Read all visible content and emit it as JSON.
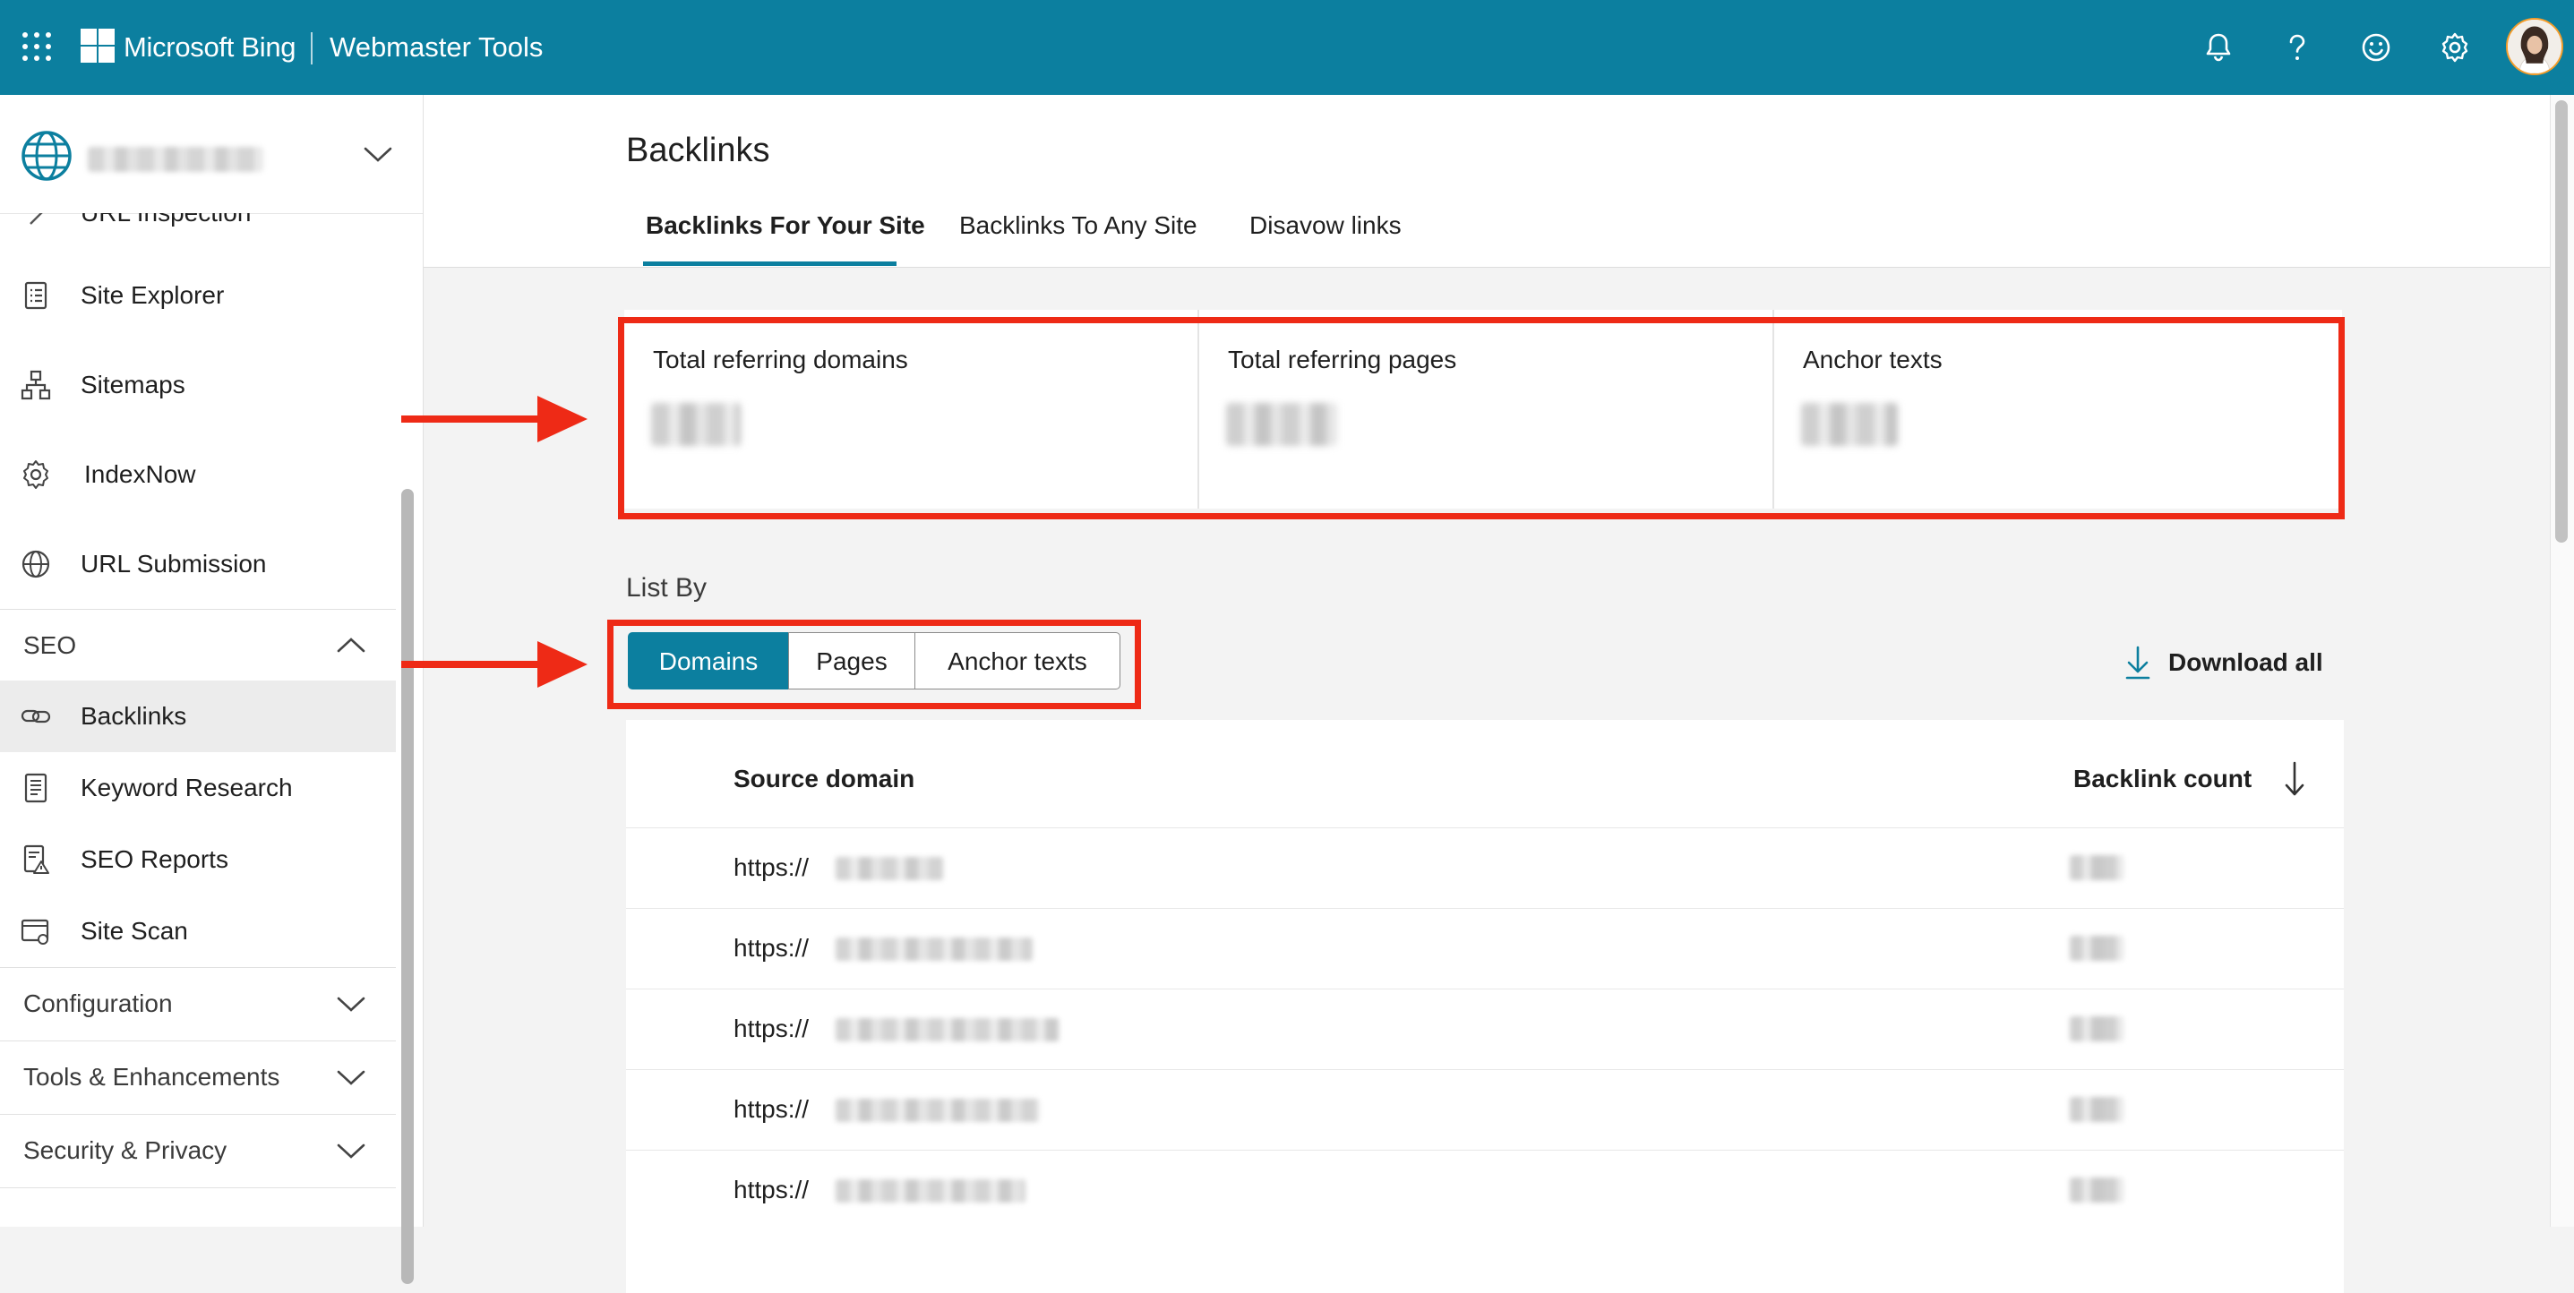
{
  "topbar": {
    "brand": "Microsoft Bing",
    "product": "Webmaster Tools",
    "icons": [
      "waffle-icon",
      "microsoft-logo-icon",
      "bell-icon",
      "help-icon",
      "smiley-icon",
      "gear-icon",
      "avatar"
    ]
  },
  "sidebar": {
    "site_picker_icon": "globe-icon",
    "items": [
      {
        "label": "URL Inspection",
        "icon": "chevron-right-icon"
      },
      {
        "label": "Site Explorer",
        "icon": "clipboard-list-icon"
      },
      {
        "label": "Sitemaps",
        "icon": "sitemap-icon"
      },
      {
        "label": "IndexNow",
        "icon": "gear-badge-icon"
      },
      {
        "label": "URL Submission",
        "icon": "globe-icon"
      }
    ],
    "seo_section": "SEO",
    "seo_items": [
      {
        "label": "Backlinks",
        "icon": "link-icon"
      },
      {
        "label": "Keyword Research",
        "icon": "document-list-icon"
      },
      {
        "label": "SEO Reports",
        "icon": "report-warning-icon"
      },
      {
        "label": "Site Scan",
        "icon": "browser-scan-icon"
      }
    ],
    "sections": [
      "Configuration",
      "Tools & Enhancements",
      "Security & Privacy"
    ]
  },
  "page": {
    "title": "Backlinks",
    "tabs": [
      "Backlinks For Your Site",
      "Backlinks To Any Site",
      "Disavow links"
    ],
    "active_tab": 0
  },
  "stats": [
    {
      "label": "Total referring domains"
    },
    {
      "label": "Total referring pages"
    },
    {
      "label": "Anchor texts"
    }
  ],
  "list_by": {
    "label": "List By",
    "options": [
      "Domains",
      "Pages",
      "Anchor texts"
    ],
    "selected": 0
  },
  "download": {
    "label": "Download all",
    "icon": "download-icon"
  },
  "table": {
    "columns": [
      "Source domain",
      "Backlink count"
    ],
    "sort_icon": "arrow-down-icon",
    "rows": [
      {
        "url_prefix": "https://"
      },
      {
        "url_prefix": "https://"
      },
      {
        "url_prefix": "https://"
      },
      {
        "url_prefix": "https://"
      },
      {
        "url_prefix": "https://"
      }
    ]
  },
  "colors": {
    "brand": "#0c7f9f",
    "annotation": "#ee2a16",
    "page_bg": "#f3f3f3"
  }
}
